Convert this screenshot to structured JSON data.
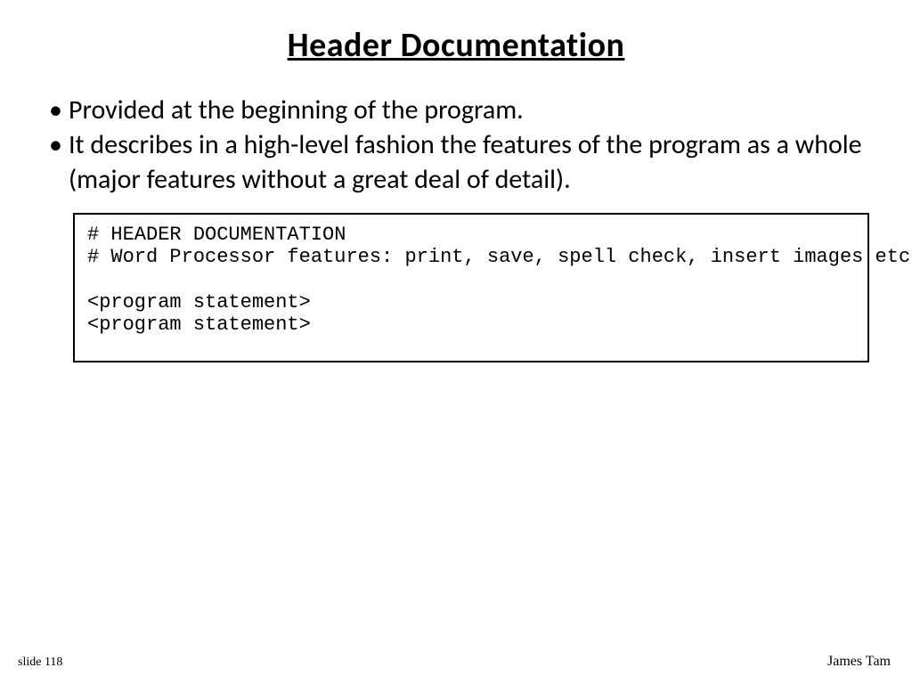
{
  "title": "Header Documentation",
  "bullets": [
    "Provided at the beginning of the program.",
    "It describes in a high-level fashion the features of the program as a whole (major features without a great deal of detail)."
  ],
  "code": "# HEADER DOCUMENTATION\n# Word Processor features: print, save, spell check, insert images etc.\n\n<program statement>\n<program statement>",
  "footer": {
    "left": "slide 118",
    "right": "James Tam"
  }
}
